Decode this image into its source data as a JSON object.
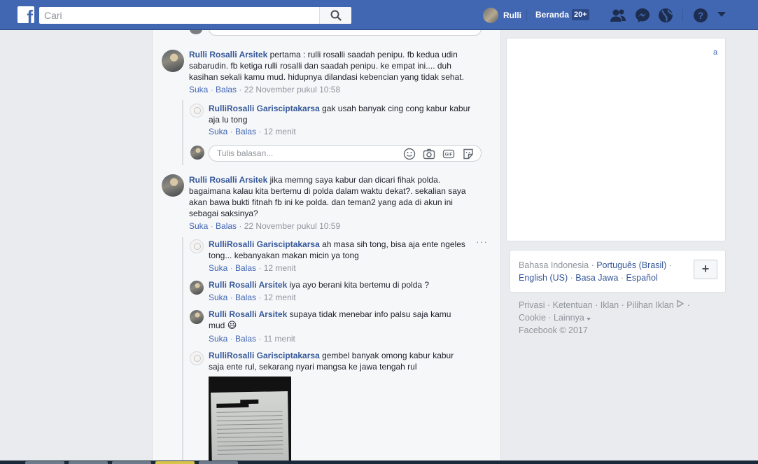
{
  "header": {
    "logo": "f",
    "search_placeholder": "Cari",
    "user_name": "Rulli",
    "home_label": "Beranda",
    "home_badge": "20+"
  },
  "feed": {
    "comments": [
      {
        "author": "Rulli Rosalli Arsitek",
        "lines": [
          "pertama : rulli rosalli saadah penipu. fb kedua udin",
          "sabarudin. fb ketiga rulli rosalli dan saadah penipu. ke empat ini.... duh",
          "kasihan sekali kamu mud. hidupnya dilandasi kebencian yang tidak sehat."
        ],
        "like": "Suka",
        "reply": "Balas",
        "time": "22 November pukul 10:58"
      },
      {
        "author": "Rulli Rosalli Arsitek",
        "lines": [
          "jika memng saya kabur dan dicari fihak polda.",
          "bagaimana kalau kita bertemu di polda dalam waktu dekat?. sekalian saya",
          "akan bawa bukti fitnah fb ini ke polda. dan teman2 yang ada di akun ini",
          "sebagai saksinya?"
        ],
        "like": "Suka",
        "reply": "Balas",
        "time": "22 November pukul 10:59"
      }
    ],
    "replies_first": [
      {
        "author": "RulliRosalli Garisciptakarsa",
        "lines": [
          "gak usah banyak cing cong kabur kabur",
          "aja lu tong"
        ],
        "like": "Suka",
        "reply": "Balas",
        "time": "12 menit"
      }
    ],
    "reply_box_placeholder": "Tulis balasan...",
    "replies_second": [
      {
        "author": "RulliRosalli Garisciptakarsa",
        "lines": [
          "ah masa sih tong, bisa aja ente ngeles",
          "tong... kebanyakan makan micin ya tong"
        ],
        "like": "Suka",
        "reply": "Balas",
        "time": "12 menit"
      },
      {
        "author": "Rulli Rosalli Arsitek",
        "lines": [
          "iya ayo berani kita bertemu di polda ?"
        ],
        "like": "Suka",
        "reply": "Balas",
        "time": "12 menit"
      },
      {
        "author": "Rulli Rosalli Arsitek",
        "lines": [
          "supaya tidak menebar info palsu saja kamu",
          "mud"
        ],
        "emoji": "😃",
        "like": "Suka",
        "reply": "Balas",
        "time": "11 menit"
      },
      {
        "author": "RulliRosalli Garisciptakarsa",
        "lines": [
          "gembel banyak omong kabur kabur",
          "saja ente rul, sekarang nyari mangsa ke jawa tengah rul"
        ]
      }
    ]
  },
  "sidebar": {
    "card_link": "a",
    "languages": {
      "primary": "Bahasa Indonesia",
      "links": [
        "Português (Brasil)",
        "English (US)",
        "Basa Jawa",
        "Español"
      ],
      "add_label": "+"
    },
    "footer": {
      "links": [
        "Privasi",
        "Ketentuan",
        "Iklan",
        "Pilihan Iklan",
        "Cookie",
        "Lainnya"
      ],
      "copyright": "Facebook © 2017"
    }
  },
  "colors": {
    "brand": "#4267b2",
    "link": "#365899",
    "meta": "#90949c"
  }
}
